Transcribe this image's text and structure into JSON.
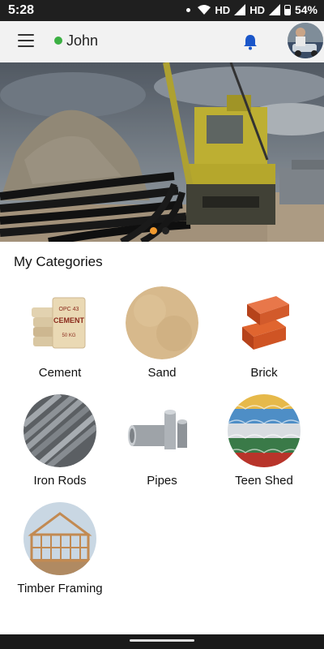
{
  "status_bar": {
    "time": "5:28",
    "network_1": "HD",
    "network_2": "HD",
    "battery": "54%"
  },
  "app_bar": {
    "user_name": "John",
    "status": "online"
  },
  "banner": {
    "slides_total": 2,
    "active_slide": 1
  },
  "section": {
    "title": "My Categories"
  },
  "categories": [
    {
      "label": "Cement",
      "icon": "cement-bags-icon"
    },
    {
      "label": "Sand",
      "icon": "sand-icon"
    },
    {
      "label": "Brick",
      "icon": "brick-icon"
    },
    {
      "label": "Iron Rods",
      "icon": "iron-rods-icon"
    },
    {
      "label": "Pipes",
      "icon": "pipes-icon"
    },
    {
      "label": "Teen Shed",
      "icon": "roof-sheet-icon"
    },
    {
      "label": "Timber Framing",
      "icon": "timber-framing-icon"
    }
  ],
  "colors": {
    "accent": "#f29a2e",
    "online": "#3cb043",
    "bell": "#1a56c9",
    "statusbar": "#1f1f1f"
  }
}
